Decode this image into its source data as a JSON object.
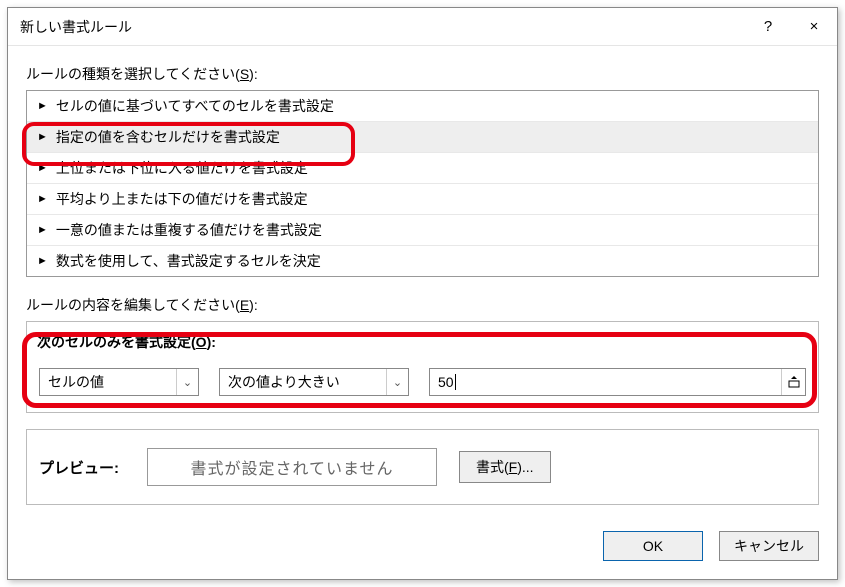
{
  "title": "新しい書式ルール",
  "help_icon": "?",
  "close_icon": "×",
  "select_rule_type_label": "ルールの種類を選択してください(",
  "select_rule_type_key": "S",
  "select_rule_type_tail": "):",
  "rule_types": [
    "セルの値に基づいてすべてのセルを書式設定",
    "指定の値を含むセルだけを書式設定",
    "上位または下位に入る値だけを書式設定",
    "平均より上または下の値だけを書式設定",
    "一意の値または重複する値だけを書式設定",
    "数式を使用して、書式設定するセルを決定"
  ],
  "selected_rule_index": 1,
  "edit_rule_label": "ルールの内容を編集してください(",
  "edit_rule_key": "E",
  "edit_rule_tail": "):",
  "criteria_label": "次のセルのみを書式設定(",
  "criteria_key": "O",
  "criteria_tail": "):",
  "combo1_value": "セルの値",
  "combo2_value": "次の値より大きい",
  "input_value": "50",
  "preview_label": "プレビュー:",
  "preview_text": "書式が設定されていません",
  "format_btn_label": "書式(",
  "format_btn_key": "F",
  "format_btn_tail": ")...",
  "ok_label": "OK",
  "cancel_label": "キャンセル"
}
